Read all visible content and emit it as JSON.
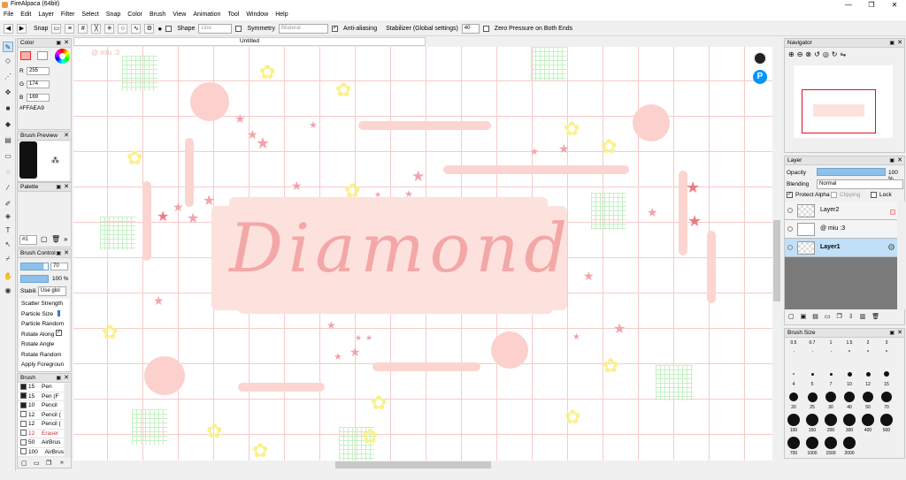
{
  "window": {
    "title": "FireAlpaca (64bit)",
    "minimize": "—",
    "maximize": "❐",
    "close": "✕"
  },
  "menu": [
    "File",
    "Edit",
    "Layer",
    "Filter",
    "Select",
    "Snap",
    "Color",
    "Brush",
    "View",
    "Animation",
    "Tool",
    "Window",
    "Help"
  ],
  "toolbar": {
    "snap_label": "Snap",
    "shape_label": "Shape",
    "shape_value": "Line",
    "symmetry_label": "Symmetry",
    "symmetry_value": "Bilateral",
    "antialias_label": "Anti-aliasing",
    "stabilizer_label": "Stabilizer (Global settings)",
    "stabilizer_value": "40",
    "zero_pressure_label": "Zero Pressure on Both Ends"
  },
  "color_panel": {
    "title": "Color",
    "r_label": "R",
    "r": "255",
    "g_label": "G",
    "g": "174",
    "b_label": "B",
    "b": "169",
    "hex": "#FFAEA9",
    "primary_color": "#ffaea9"
  },
  "brush_preview": {
    "title": "Brush Preview"
  },
  "palette": {
    "title": "Palette",
    "selector": "#1"
  },
  "brush_control": {
    "title": "Brush Control",
    "size": "70",
    "opacity": "100 %",
    "stabilizer_label": "Stabili",
    "stabilizer_value": "Use glol",
    "options": [
      "Scatter Strength",
      "Particle Size",
      "Particle Random",
      "Rotate Along",
      "Rotate Angle",
      "Rotate Random",
      "Apply Foregroun"
    ]
  },
  "brush_list": {
    "title": "Brush",
    "items": [
      {
        "size": "15",
        "name": "Pen"
      },
      {
        "size": "15",
        "name": "Pen (F"
      },
      {
        "size": "10",
        "name": "Pencil"
      },
      {
        "size": "12",
        "name": "Pencil ("
      },
      {
        "size": "12",
        "name": "Pencil ("
      },
      {
        "size": "12",
        "name": "Eraser"
      },
      {
        "size": "50",
        "name": "AirBrus"
      },
      {
        "size": "100",
        "name": "AirBrus"
      }
    ]
  },
  "canvas": {
    "tab_title": "Untitled",
    "watermark": "@ miu :3",
    "artwork_text": "Diamond"
  },
  "navigator": {
    "title": "Navigator"
  },
  "layer_panel": {
    "title": "Layer",
    "opacity_label": "Opacity",
    "opacity_value": "100 %",
    "opacity_fraction": 1.0,
    "blending_label": "Blending",
    "blending_value": "Normal",
    "protect_alpha": "Protect Alpha",
    "clipping": "Clipping",
    "lock": "Lock",
    "layers": [
      {
        "name": "Layer2"
      },
      {
        "name": "@ miu :3"
      },
      {
        "name": "Layer1"
      }
    ]
  },
  "brush_size": {
    "title": "Brush Size",
    "sizes": [
      "0.5",
      "0.7",
      "1",
      "1.5",
      "2",
      "3",
      "4",
      "5",
      "7",
      "10",
      "12",
      "15",
      "20",
      "25",
      "30",
      "40",
      "50",
      "70",
      "100",
      "150",
      "200",
      "300",
      "400",
      "500",
      "700",
      "1000",
      "1500",
      "2000"
    ]
  }
}
